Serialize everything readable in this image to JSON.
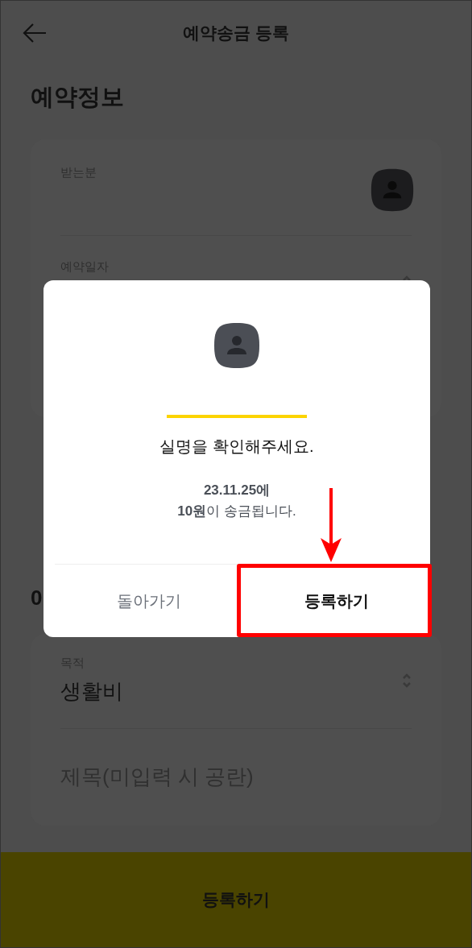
{
  "header": {
    "title": "예약송금 등록"
  },
  "section_title": "예약정보",
  "card_1": {
    "fields": [
      {
        "kind": "contact",
        "label": "받는분"
      },
      {
        "kind": "select",
        "label": "예약일자"
      }
    ]
  },
  "section_2_title": "0",
  "card_2": {
    "fields": [
      {
        "kind": "select",
        "label": "목적",
        "value": "생활비"
      },
      {
        "kind": "text",
        "placeholder": "제목(미입력 시 공란)"
      }
    ]
  },
  "bottom_button": "등록하기",
  "dialog": {
    "message": "실명을 확인해주세요.",
    "details": "**23.11.25에**\n**10원**이 송금됩니다.",
    "buttons": [
      {
        "label": "돌아가기",
        "kind": "secondary",
        "highlighted": false
      },
      {
        "label": "등록하기",
        "kind": "primary",
        "highlighted": true
      }
    ]
  }
}
